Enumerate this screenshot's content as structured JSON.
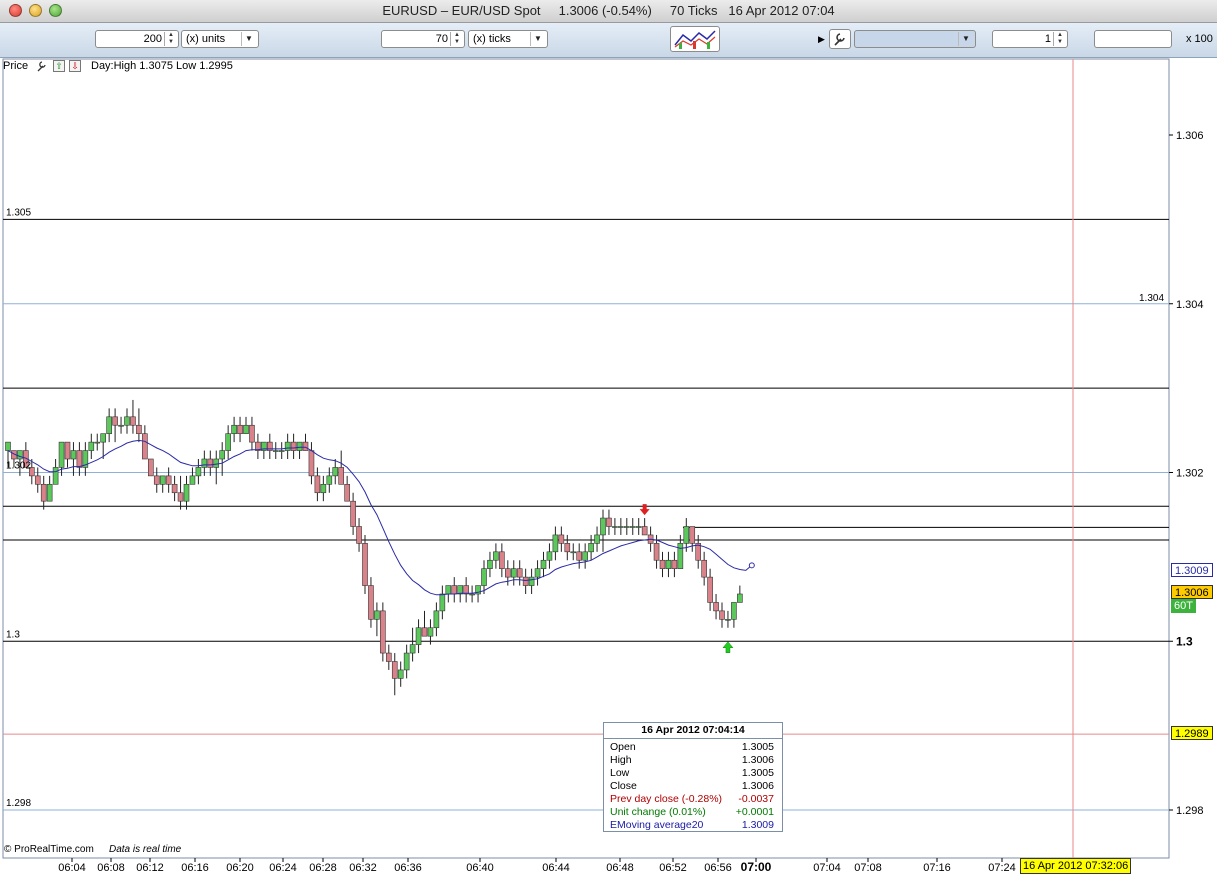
{
  "window": {
    "title": "EURUSD – EUR/USD Spot     1.3006 (-0.54%)     70 Ticks   16 Apr 2012 07:04"
  },
  "toolbar": {
    "units_value": "200",
    "units_label": "(x) units",
    "ticks_value": "70",
    "ticks_label": "(x) ticks",
    "scale_value": "1",
    "scale_suffix": "x 100",
    "indicator_select": "",
    "extra_field": ""
  },
  "panel": {
    "label": "Price",
    "day_range": "Day:High 1.3075 Low 1.2995"
  },
  "footer": {
    "copyright": "© ProRealTime.com",
    "realtime": "Data is real time",
    "cursor_time": "16 Apr 2012 07:32:06"
  },
  "y_axis_labels": {
    "right": [
      "1.306",
      "1.304",
      "1.302",
      "1.3",
      "1.298"
    ],
    "left": [
      "1.305",
      "1.302",
      "1.3",
      "1.298"
    ],
    "inline_1304": "1.304"
  },
  "x_axis_labels": [
    "06:04",
    "06:08",
    "06:12",
    "06:16",
    "06:20",
    "06:24",
    "06:28",
    "06:32",
    "06:36",
    "06:40",
    "06:44",
    "06:48",
    "06:52",
    "06:56",
    "07:00",
    "07:04",
    "07:08",
    "07:16",
    "07:24"
  ],
  "tags": {
    "ema": "1.3009",
    "last": "1.3006",
    "ticks": "60T",
    "pink_line": "1.2989"
  },
  "info": {
    "title": "16 Apr 2012 07:04:14",
    "rows": [
      {
        "label": "Open",
        "value": "1.3005",
        "color": "#000000"
      },
      {
        "label": "High",
        "value": "1.3006",
        "color": "#000000"
      },
      {
        "label": "Low",
        "value": "1.3005",
        "color": "#000000"
      },
      {
        "label": "Close",
        "value": "1.3006",
        "color": "#000000"
      },
      {
        "label": "Prev day close (-0.28%)",
        "value": "-0.0037",
        "color": "#b00000"
      },
      {
        "label": "Unit change (0.01%)",
        "value": "+0.0001",
        "color": "#007a00"
      },
      {
        "label": "EMoving average20",
        "value": "1.3009",
        "color": "#1a1aa6"
      }
    ]
  },
  "colors": {
    "bull": "#5cc85c",
    "bear": "#d9828a",
    "ema": "#2a2aa8",
    "gridline": "#8fb0d8",
    "pink": "#e88a8a",
    "last_tag": "#ffcc00",
    "ticks_tag": "#3db33d",
    "cursor_tag": "#ffff00"
  },
  "chart_data": {
    "type": "candlestick",
    "ylim": [
      1.2973,
      1.3074
    ],
    "ema_label": "EMoving average20",
    "horizontal_levels": [
      1.305,
      1.303,
      1.3016,
      1.3012,
      1.3
    ],
    "candles": [
      {
        "o": 1.30226,
        "h": 1.30236,
        "l": 1.30206,
        "c": 1.30236
      },
      {
        "o": 1.30226,
        "h": 1.30226,
        "l": 1.30206,
        "c": 1.30216
      },
      {
        "o": 1.30216,
        "h": 1.30226,
        "l": 1.30196,
        "c": 1.30226
      },
      {
        "o": 1.30226,
        "h": 1.30236,
        "l": 1.30206,
        "c": 1.30206
      },
      {
        "o": 1.30206,
        "h": 1.30216,
        "l": 1.30186,
        "c": 1.30196
      },
      {
        "o": 1.30196,
        "h": 1.30206,
        "l": 1.30176,
        "c": 1.30186
      },
      {
        "o": 1.30186,
        "h": 1.30196,
        "l": 1.30156,
        "c": 1.30166
      },
      {
        "o": 1.30166,
        "h": 1.30196,
        "l": 1.30166,
        "c": 1.30186
      },
      {
        "o": 1.30186,
        "h": 1.30216,
        "l": 1.30186,
        "c": 1.30206
      },
      {
        "o": 1.30206,
        "h": 1.30236,
        "l": 1.30196,
        "c": 1.30236
      },
      {
        "o": 1.30236,
        "h": 1.30236,
        "l": 1.30206,
        "c": 1.30216
      },
      {
        "o": 1.30216,
        "h": 1.30236,
        "l": 1.30196,
        "c": 1.30226
      },
      {
        "o": 1.30226,
        "h": 1.30236,
        "l": 1.30196,
        "c": 1.30206
      },
      {
        "o": 1.30206,
        "h": 1.30236,
        "l": 1.30196,
        "c": 1.30226
      },
      {
        "o": 1.30226,
        "h": 1.30246,
        "l": 1.30216,
        "c": 1.30236
      },
      {
        "o": 1.30236,
        "h": 1.30246,
        "l": 1.30226,
        "c": 1.30236
      },
      {
        "o": 1.30236,
        "h": 1.30246,
        "l": 1.30216,
        "c": 1.30246
      },
      {
        "o": 1.30246,
        "h": 1.30276,
        "l": 1.30236,
        "c": 1.30266
      },
      {
        "o": 1.30266,
        "h": 1.30276,
        "l": 1.30236,
        "c": 1.30256
      },
      {
        "o": 1.30256,
        "h": 1.30266,
        "l": 1.30246,
        "c": 1.30256
      },
      {
        "o": 1.30256,
        "h": 1.30276,
        "l": 1.30246,
        "c": 1.30266
      },
      {
        "o": 1.30266,
        "h": 1.30286,
        "l": 1.30246,
        "c": 1.30256
      },
      {
        "o": 1.30256,
        "h": 1.30276,
        "l": 1.30236,
        "c": 1.30246
      },
      {
        "o": 1.30246,
        "h": 1.30256,
        "l": 1.30216,
        "c": 1.30216
      },
      {
        "o": 1.30216,
        "h": 1.30216,
        "l": 1.30196,
        "c": 1.30196
      },
      {
        "o": 1.30196,
        "h": 1.30206,
        "l": 1.30176,
        "c": 1.30186
      },
      {
        "o": 1.30186,
        "h": 1.30196,
        "l": 1.30176,
        "c": 1.30196
      },
      {
        "o": 1.30196,
        "h": 1.30206,
        "l": 1.30176,
        "c": 1.30186
      },
      {
        "o": 1.30186,
        "h": 1.30196,
        "l": 1.30166,
        "c": 1.30176
      },
      {
        "o": 1.30176,
        "h": 1.30196,
        "l": 1.30156,
        "c": 1.30166
      },
      {
        "o": 1.30166,
        "h": 1.30196,
        "l": 1.30156,
        "c": 1.30186
      },
      {
        "o": 1.30186,
        "h": 1.30206,
        "l": 1.30186,
        "c": 1.30196
      },
      {
        "o": 1.30196,
        "h": 1.30216,
        "l": 1.30186,
        "c": 1.30206
      },
      {
        "o": 1.30206,
        "h": 1.30226,
        "l": 1.30196,
        "c": 1.30216
      },
      {
        "o": 1.30216,
        "h": 1.30226,
        "l": 1.30196,
        "c": 1.30206
      },
      {
        "o": 1.30206,
        "h": 1.30226,
        "l": 1.30186,
        "c": 1.30216
      },
      {
        "o": 1.30216,
        "h": 1.30236,
        "l": 1.30196,
        "c": 1.30226
      },
      {
        "o": 1.30226,
        "h": 1.30256,
        "l": 1.30216,
        "c": 1.30246
      },
      {
        "o": 1.30246,
        "h": 1.30266,
        "l": 1.30236,
        "c": 1.30256
      },
      {
        "o": 1.30256,
        "h": 1.30266,
        "l": 1.30236,
        "c": 1.30246
      },
      {
        "o": 1.30246,
        "h": 1.30266,
        "l": 1.30246,
        "c": 1.30256
      },
      {
        "o": 1.30256,
        "h": 1.30266,
        "l": 1.30226,
        "c": 1.30236
      },
      {
        "o": 1.30236,
        "h": 1.30246,
        "l": 1.30216,
        "c": 1.30226
      },
      {
        "o": 1.30226,
        "h": 1.30236,
        "l": 1.30216,
        "c": 1.30236
      },
      {
        "o": 1.30236,
        "h": 1.30246,
        "l": 1.30216,
        "c": 1.30226
      },
      {
        "o": 1.30226,
        "h": 1.30236,
        "l": 1.30216,
        "c": 1.30226
      },
      {
        "o": 1.30226,
        "h": 1.30236,
        "l": 1.30216,
        "c": 1.30226
      },
      {
        "o": 1.30226,
        "h": 1.30246,
        "l": 1.30216,
        "c": 1.30236
      },
      {
        "o": 1.30236,
        "h": 1.30246,
        "l": 1.30216,
        "c": 1.30226
      },
      {
        "o": 1.30226,
        "h": 1.30236,
        "l": 1.30216,
        "c": 1.30236
      },
      {
        "o": 1.30236,
        "h": 1.30246,
        "l": 1.30226,
        "c": 1.30226
      },
      {
        "o": 1.30226,
        "h": 1.30236,
        "l": 1.30186,
        "c": 1.30196
      },
      {
        "o": 1.30196,
        "h": 1.30206,
        "l": 1.30166,
        "c": 1.30176
      },
      {
        "o": 1.30176,
        "h": 1.30196,
        "l": 1.30166,
        "c": 1.30186
      },
      {
        "o": 1.30186,
        "h": 1.30206,
        "l": 1.30176,
        "c": 1.30196
      },
      {
        "o": 1.30196,
        "h": 1.30216,
        "l": 1.30186,
        "c": 1.30206
      },
      {
        "o": 1.30206,
        "h": 1.30226,
        "l": 1.30186,
        "c": 1.30186
      },
      {
        "o": 1.30186,
        "h": 1.30196,
        "l": 1.30166,
        "c": 1.30166
      },
      {
        "o": 1.30166,
        "h": 1.30176,
        "l": 1.30126,
        "c": 1.30136
      },
      {
        "o": 1.30136,
        "h": 1.30146,
        "l": 1.30106,
        "c": 1.30116
      },
      {
        "o": 1.30116,
        "h": 1.30126,
        "l": 1.30056,
        "c": 1.30066
      },
      {
        "o": 1.30066,
        "h": 1.30076,
        "l": 1.30016,
        "c": 1.30026
      },
      {
        "o": 1.30026,
        "h": 1.30046,
        "l": 1.30006,
        "c": 1.30036
      },
      {
        "o": 1.30036,
        "h": 1.30046,
        "l": 1.29976,
        "c": 1.29986
      },
      {
        "o": 1.29986,
        "h": 1.29996,
        "l": 1.29966,
        "c": 1.29976
      },
      {
        "o": 1.29976,
        "h": 1.29986,
        "l": 1.29936,
        "c": 1.29956
      },
      {
        "o": 1.29956,
        "h": 1.29976,
        "l": 1.29946,
        "c": 1.29966
      },
      {
        "o": 1.29966,
        "h": 1.29996,
        "l": 1.29956,
        "c": 1.29986
      },
      {
        "o": 1.29986,
        "h": 1.30016,
        "l": 1.29976,
        "c": 1.29996
      },
      {
        "o": 1.29996,
        "h": 1.30026,
        "l": 1.29986,
        "c": 1.30016
      },
      {
        "o": 1.30016,
        "h": 1.30036,
        "l": 1.30006,
        "c": 1.30006
      },
      {
        "o": 1.30006,
        "h": 1.30026,
        "l": 1.29996,
        "c": 1.30016
      },
      {
        "o": 1.30016,
        "h": 1.30046,
        "l": 1.30006,
        "c": 1.30036
      },
      {
        "o": 1.30036,
        "h": 1.30066,
        "l": 1.30026,
        "c": 1.30056
      },
      {
        "o": 1.30056,
        "h": 1.30066,
        "l": 1.30046,
        "c": 1.30066
      },
      {
        "o": 1.30066,
        "h": 1.30076,
        "l": 1.30046,
        "c": 1.30056
      },
      {
        "o": 1.30056,
        "h": 1.30066,
        "l": 1.30046,
        "c": 1.30066
      },
      {
        "o": 1.30066,
        "h": 1.30076,
        "l": 1.30046,
        "c": 1.30056
      },
      {
        "o": 1.30056,
        "h": 1.30066,
        "l": 1.30046,
        "c": 1.30056
      },
      {
        "o": 1.30056,
        "h": 1.30066,
        "l": 1.30046,
        "c": 1.30066
      },
      {
        "o": 1.30066,
        "h": 1.30096,
        "l": 1.30056,
        "c": 1.30086
      },
      {
        "o": 1.30086,
        "h": 1.30106,
        "l": 1.30076,
        "c": 1.30096
      },
      {
        "o": 1.30096,
        "h": 1.30116,
        "l": 1.30086,
        "c": 1.30106
      },
      {
        "o": 1.30106,
        "h": 1.30116,
        "l": 1.30076,
        "c": 1.30086
      },
      {
        "o": 1.30086,
        "h": 1.30096,
        "l": 1.30066,
        "c": 1.30076
      },
      {
        "o": 1.30076,
        "h": 1.30096,
        "l": 1.30066,
        "c": 1.30086
      },
      {
        "o": 1.30086,
        "h": 1.30096,
        "l": 1.30066,
        "c": 1.30076
      },
      {
        "o": 1.30076,
        "h": 1.30086,
        "l": 1.30056,
        "c": 1.30066
      },
      {
        "o": 1.30066,
        "h": 1.30086,
        "l": 1.30056,
        "c": 1.30076
      },
      {
        "o": 1.30076,
        "h": 1.30096,
        "l": 1.30066,
        "c": 1.30086
      },
      {
        "o": 1.30086,
        "h": 1.30106,
        "l": 1.30076,
        "c": 1.30096
      },
      {
        "o": 1.30096,
        "h": 1.30116,
        "l": 1.30086,
        "c": 1.30106
      },
      {
        "o": 1.30106,
        "h": 1.30136,
        "l": 1.30096,
        "c": 1.30126
      },
      {
        "o": 1.30126,
        "h": 1.30136,
        "l": 1.30106,
        "c": 1.30116
      },
      {
        "o": 1.30116,
        "h": 1.30126,
        "l": 1.30096,
        "c": 1.30106
      },
      {
        "o": 1.30106,
        "h": 1.30116,
        "l": 1.30096,
        "c": 1.30106
      },
      {
        "o": 1.30106,
        "h": 1.30116,
        "l": 1.30086,
        "c": 1.30096
      },
      {
        "o": 1.30096,
        "h": 1.30116,
        "l": 1.30086,
        "c": 1.30106
      },
      {
        "o": 1.30106,
        "h": 1.30126,
        "l": 1.30096,
        "c": 1.30116
      },
      {
        "o": 1.30116,
        "h": 1.30136,
        "l": 1.30106,
        "c": 1.30126
      },
      {
        "o": 1.30126,
        "h": 1.30156,
        "l": 1.30106,
        "c": 1.30146
      },
      {
        "o": 1.30146,
        "h": 1.30156,
        "l": 1.30126,
        "c": 1.30136
      },
      {
        "o": 1.30136,
        "h": 1.30146,
        "l": 1.30126,
        "c": 1.30136
      },
      {
        "o": 1.30136,
        "h": 1.30146,
        "l": 1.30126,
        "c": 1.30136
      },
      {
        "o": 1.30136,
        "h": 1.30146,
        "l": 1.30126,
        "c": 1.30136
      },
      {
        "o": 1.30136,
        "h": 1.30146,
        "l": 1.30126,
        "c": 1.30136
      },
      {
        "o": 1.30136,
        "h": 1.30146,
        "l": 1.30126,
        "c": 1.30136
      },
      {
        "o": 1.30136,
        "h": 1.30146,
        "l": 1.30126,
        "c": 1.30126
      },
      {
        "o": 1.30126,
        "h": 1.30136,
        "l": 1.30106,
        "c": 1.30116
      },
      {
        "o": 1.30116,
        "h": 1.30126,
        "l": 1.30086,
        "c": 1.30096
      },
      {
        "o": 1.30096,
        "h": 1.30106,
        "l": 1.30076,
        "c": 1.30086
      },
      {
        "o": 1.30086,
        "h": 1.30106,
        "l": 1.30076,
        "c": 1.30096
      },
      {
        "o": 1.30096,
        "h": 1.30106,
        "l": 1.30076,
        "c": 1.30086
      },
      {
        "o": 1.30086,
        "h": 1.30126,
        "l": 1.30086,
        "c": 1.30116
      },
      {
        "o": 1.30116,
        "h": 1.30146,
        "l": 1.30106,
        "c": 1.30136
      },
      {
        "o": 1.30136,
        "h": 1.30136,
        "l": 1.30106,
        "c": 1.30116
      },
      {
        "o": 1.30116,
        "h": 1.30126,
        "l": 1.30086,
        "c": 1.30096
      },
      {
        "o": 1.30096,
        "h": 1.30106,
        "l": 1.30066,
        "c": 1.30076
      },
      {
        "o": 1.30076,
        "h": 1.30086,
        "l": 1.30036,
        "c": 1.30046
      },
      {
        "o": 1.30046,
        "h": 1.30056,
        "l": 1.30026,
        "c": 1.30036
      },
      {
        "o": 1.30036,
        "h": 1.30046,
        "l": 1.30016,
        "c": 1.30026
      },
      {
        "o": 1.30026,
        "h": 1.30036,
        "l": 1.30016,
        "c": 1.30026
      },
      {
        "o": 1.30026,
        "h": 1.30046,
        "l": 1.30016,
        "c": 1.30046
      },
      {
        "o": 1.30046,
        "h": 1.30066,
        "l": 1.30046,
        "c": 1.30056
      }
    ],
    "ema": [
      1.30226,
      1.30222,
      1.30219,
      1.30217,
      1.30213,
      1.30209,
      1.30204,
      1.30201,
      1.30201,
      1.30204,
      1.30205,
      1.30207,
      1.30207,
      1.30209,
      1.30212,
      1.30215,
      1.30219,
      1.30224,
      1.30228,
      1.30231,
      1.30235,
      1.30237,
      1.30238,
      1.30237,
      1.30233,
      1.30229,
      1.30226,
      1.30222,
      1.30217,
      1.30212,
      1.3021,
      1.30208,
      1.30208,
      1.30209,
      1.30209,
      1.3021,
      1.30211,
      1.30215,
      1.30219,
      1.30222,
      1.30226,
      1.30227,
      1.30227,
      1.30228,
      1.30228,
      1.30228,
      1.30228,
      1.30229,
      1.30229,
      1.3023,
      1.3023,
      1.30226,
      1.30221,
      1.30217,
      1.30215,
      1.30214,
      1.30211,
      1.30206,
      1.30198,
      1.30189,
      1.30177,
      1.30162,
      1.3015,
      1.30134,
      1.30118,
      1.30103,
      1.3009,
      1.3008,
      1.30072,
      1.30067,
      1.30061,
      1.30057,
      1.30055,
      1.30055,
      1.30056,
      1.30056,
      1.30057,
      1.30057,
      1.30057,
      1.30058,
      1.3006,
      1.30064,
      1.30068,
      1.3007,
      1.30071,
      1.30073,
      1.30073,
      1.30072,
      1.30073,
      1.30074,
      1.30077,
      1.3008,
      1.30085,
      1.30088,
      1.3009,
      1.30092,
      1.30093,
      1.30094,
      1.30096,
      1.301,
      1.30104,
      1.30107,
      1.3011,
      1.30113,
      1.30115,
      1.30117,
      1.30119,
      1.3012,
      1.30121,
      1.3012,
      1.30117,
      1.30114,
      1.30112,
      1.3011,
      1.30111,
      1.30113,
      1.30114,
      1.30112,
      1.30109,
      1.30103,
      1.30097,
      1.30091,
      1.30087,
      1.30085,
      1.30084
    ],
    "arrows": [
      {
        "type": "down",
        "index": 107
      },
      {
        "type": "up",
        "index": 121
      }
    ]
  }
}
